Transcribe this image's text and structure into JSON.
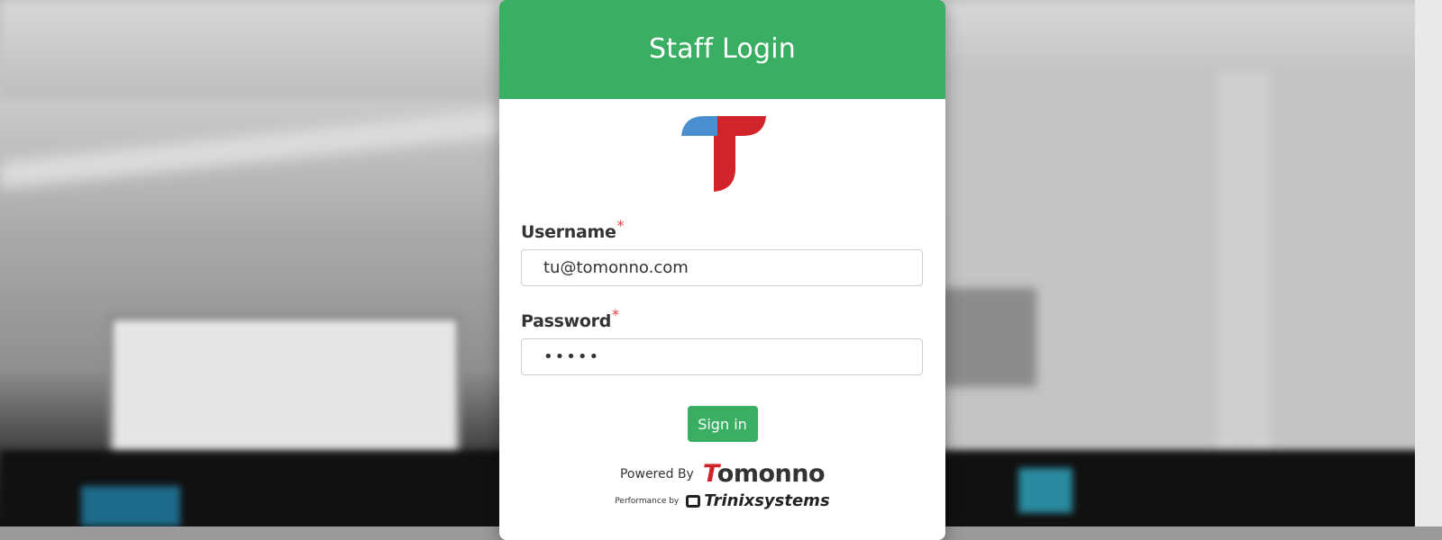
{
  "page": {
    "title": "Staff Login"
  },
  "form": {
    "username_label": "Username",
    "username_required_mark": "*",
    "username_value": "tu@tomonno.com",
    "password_label": "Password",
    "password_required_mark": "*",
    "password_value": "•••••",
    "submit_label": "Sign in"
  },
  "footer": {
    "powered_label": "Powered By",
    "brand_first": "T",
    "brand_rest": "omonno",
    "performance_label": "Performance by",
    "partner_name": "Trinixsystems"
  },
  "colors": {
    "accent": "#3aae63",
    "logo_blue": "#4a8fd0",
    "logo_red": "#d0232a",
    "required": "#e23a3a"
  },
  "icons": {
    "app_logo": "tomonno-t-logo",
    "partner_logo": "trinix-logo"
  }
}
